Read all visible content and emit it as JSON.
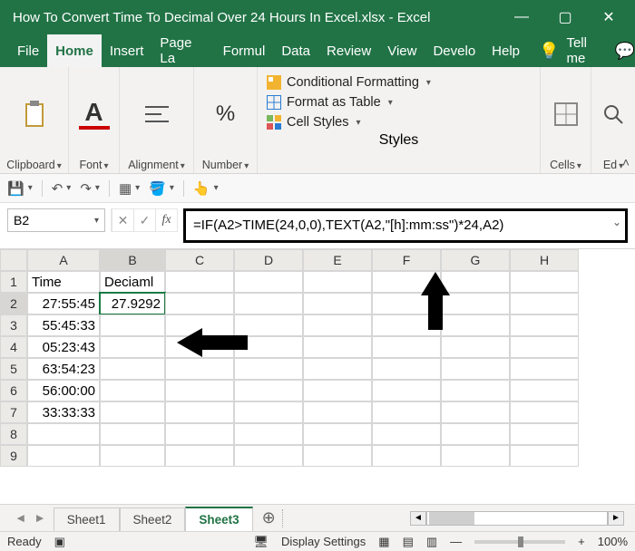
{
  "title": "How To Convert Time To Decimal Over 24 Hours In Excel.xlsx  -  Excel",
  "menu": {
    "tabs": [
      "File",
      "Home",
      "Insert",
      "Page La",
      "Formul",
      "Data",
      "Review",
      "View",
      "Develo",
      "Help"
    ],
    "active": "Home",
    "tellme": "Tell me"
  },
  "ribbon": {
    "clipboard": "Clipboard",
    "font": "Font",
    "alignment": "Alignment",
    "number": "Number",
    "styles": {
      "label": "Styles",
      "conditional": "Conditional Formatting",
      "table": "Format as Table",
      "cellstyles": "Cell Styles"
    },
    "cells": "Cells",
    "editing": "Ed"
  },
  "namebox": "B2",
  "formula": "=IF(A2>TIME(24,0,0),TEXT(A2,\"[h]:mm:ss\")*24,A2)",
  "columns": [
    "A",
    "B",
    "C",
    "D",
    "E",
    "F",
    "G",
    "H"
  ],
  "rows": [
    "1",
    "2",
    "3",
    "4",
    "5",
    "6",
    "7",
    "8",
    "9"
  ],
  "headers": {
    "A": "Time",
    "B": "Deciaml"
  },
  "dataA": {
    "2": "27:55:45",
    "3": "55:45:33",
    "4": "05:23:43",
    "5": "63:54:23",
    "6": "56:00:00",
    "7": "33:33:33"
  },
  "dataB": {
    "2": "27.9292"
  },
  "selected": {
    "col": "B",
    "row": "2"
  },
  "sheets": {
    "list": [
      "Sheet1",
      "Sheet2",
      "Sheet3"
    ],
    "active": "Sheet3"
  },
  "status": {
    "ready": "Ready",
    "display": "Display Settings",
    "zoom": "100%"
  }
}
